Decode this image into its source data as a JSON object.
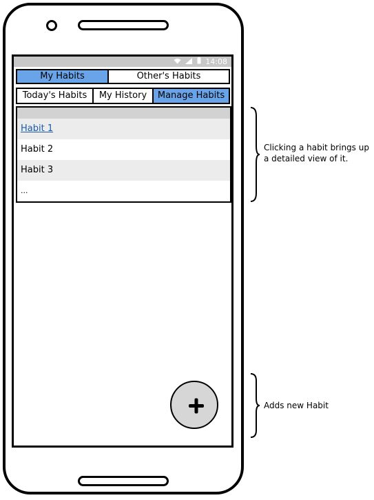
{
  "status": {
    "wifi_icon": "wifi-icon",
    "signal_icon": "signal-icon",
    "battery_icon": "battery-icon",
    "time": "14:08"
  },
  "primary_tabs": [
    {
      "label": "My Habits",
      "active": true
    },
    {
      "label": "Other's Habits",
      "active": false
    }
  ],
  "secondary_tabs": [
    {
      "label": "Today's Habits",
      "active": false
    },
    {
      "label": "My History",
      "active": false
    },
    {
      "label": "Manage Habits",
      "active": true
    }
  ],
  "habits": [
    {
      "label": "Habit 1"
    },
    {
      "label": "Habit 2"
    },
    {
      "label": "Habit 3"
    },
    {
      "label": "..."
    }
  ],
  "fab": {
    "icon": "plus-icon"
  },
  "annotations": {
    "list_note_line1": "Clicking a habit brings up",
    "list_note_line2": "a detailed view of it.",
    "fab_note": "Adds new Habit"
  },
  "colors": {
    "active_tab": "#6aa4e8",
    "link": "#1a5aa8",
    "statusbar": "#c8c8c8"
  }
}
